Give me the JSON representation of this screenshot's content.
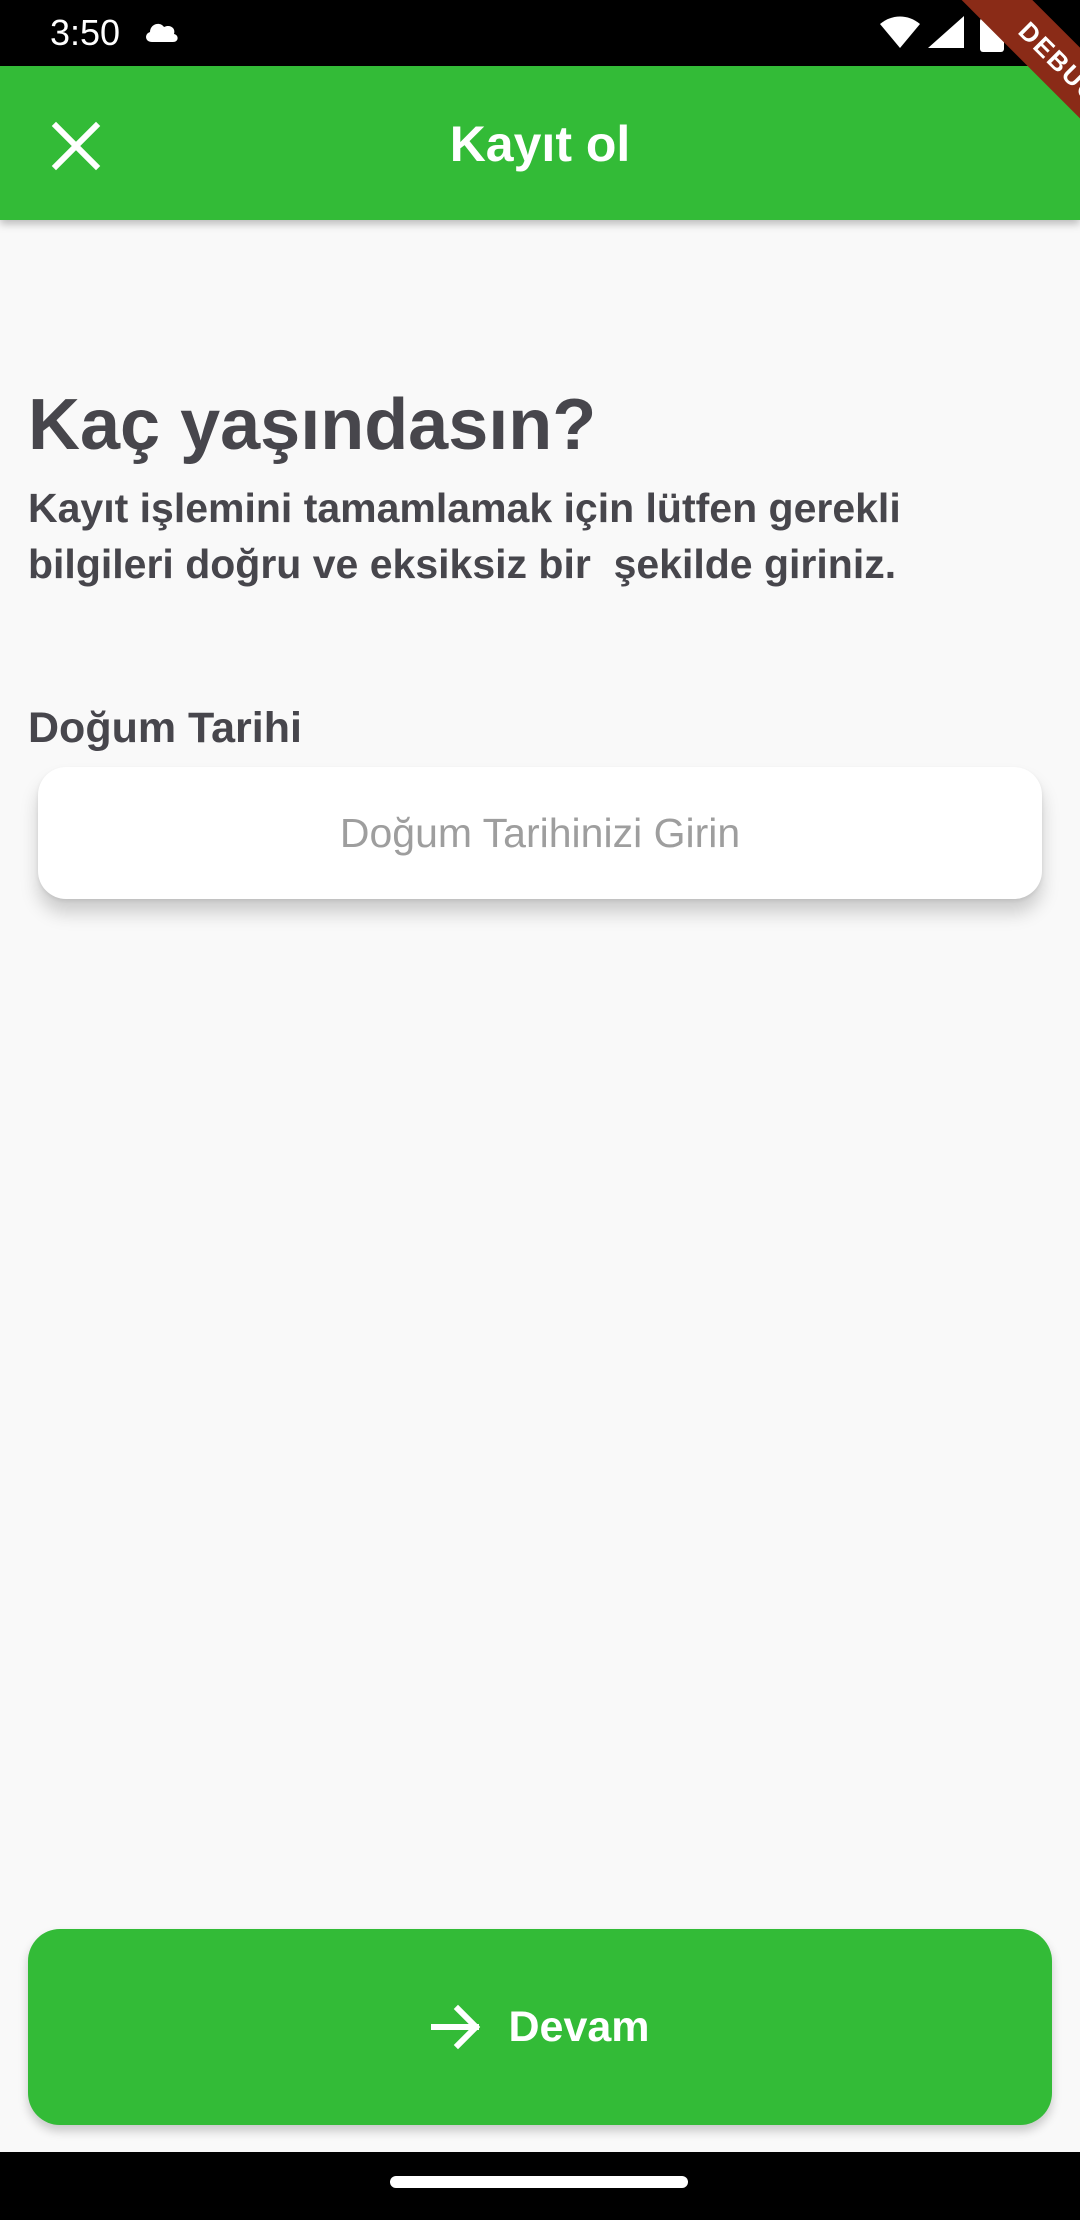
{
  "status_bar": {
    "time": "3:50",
    "icons": [
      "cloud-icon",
      "wifi-icon",
      "signal-icon",
      "battery-icon"
    ]
  },
  "app_bar": {
    "title": "Kayıt ol",
    "close_icon": "close-icon",
    "debug_banner": "DEBUG",
    "background_color": "#33bb37"
  },
  "main": {
    "heading": "Kaç yaşındasın?",
    "subtitle": "Kayıt işlemini tamamlamak için lütfen gerekli bilgileri doğru ve eksiksiz bir  şekilde giriniz.",
    "birthdate_field": {
      "label": "Doğum Tarihi",
      "value": "",
      "placeholder": "Doğum Tarihinizi Girin"
    }
  },
  "continue_button": {
    "label": "Devam",
    "icon": "arrow-right-icon",
    "background_color": "#33bb37"
  }
}
